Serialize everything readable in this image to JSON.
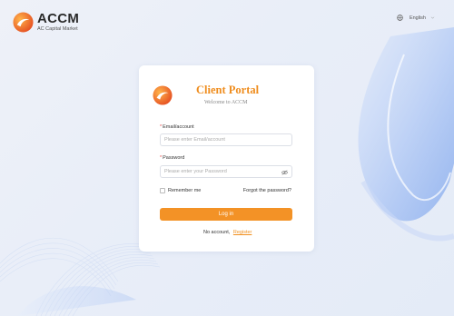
{
  "brand": {
    "name": "ACCM",
    "tagline": "AC Capital Market",
    "colors": {
      "primary": "#f39226",
      "accent": "#e9501e"
    }
  },
  "language": {
    "selected": "English",
    "icon": "globe-icon"
  },
  "login": {
    "title": "Client Portal",
    "subtitle": "Welcome to ACCM",
    "email_label": "Email/account",
    "email_placeholder": "Please enter Email/account",
    "email_value": "",
    "password_label": "Password",
    "password_placeholder": "Please enter your Password",
    "password_value": "",
    "remember_label": "Remember me",
    "remember_checked": false,
    "forgot_label": "Forgot the password?",
    "submit_label": "Log in",
    "no_account_text": "No account,",
    "register_label": "Register"
  }
}
